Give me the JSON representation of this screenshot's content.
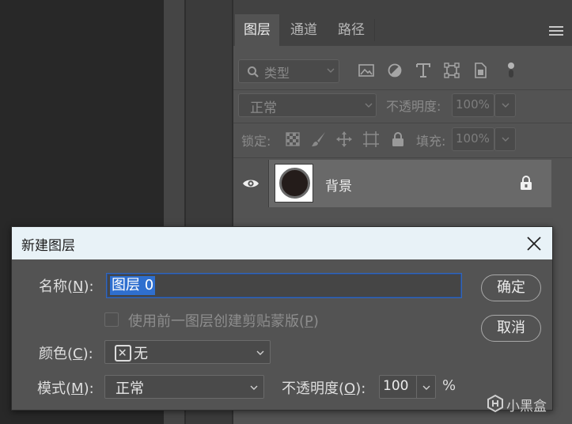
{
  "panel": {
    "tabs": [
      {
        "label": "图层",
        "active": true
      },
      {
        "label": "通道",
        "active": false
      },
      {
        "label": "路径",
        "active": false
      }
    ],
    "filter": {
      "placeholder": "类型"
    },
    "blend_mode": "正常",
    "opacity_label": "不透明度:",
    "opacity_value": "100%",
    "lock_label": "锁定:",
    "fill_label": "填充:",
    "fill_value": "100%",
    "layer": {
      "name": "背景",
      "thumbnail_color": "#241c1a"
    }
  },
  "dialog": {
    "title": "新建图层",
    "name_label_pre": "名称(",
    "name_label_key": "N",
    "name_label_post": "):",
    "name_value": "图层 0",
    "clip_label_pre": "使用前一图层创建剪贴蒙版(",
    "clip_label_key": "P",
    "clip_label_post": ")",
    "clip_checked": false,
    "color_label_pre": "颜色(",
    "color_label_key": "C",
    "color_label_post": "):",
    "color_value": "无",
    "mode_label_pre": "模式(",
    "mode_label_key": "M",
    "mode_label_post": "):",
    "mode_value": "正常",
    "opacity_label_pre": "不透明度(",
    "opacity_label_key": "O",
    "opacity_label_post": "):",
    "opacity_value": "100",
    "opacity_unit": "%",
    "ok_label": "确定",
    "cancel_label": "取消"
  },
  "colors": {
    "selection": "#2f6fcf",
    "title_bar": "#e8f2f7",
    "panel_bg": "#535353"
  },
  "watermark": {
    "text": "小黑盒"
  }
}
